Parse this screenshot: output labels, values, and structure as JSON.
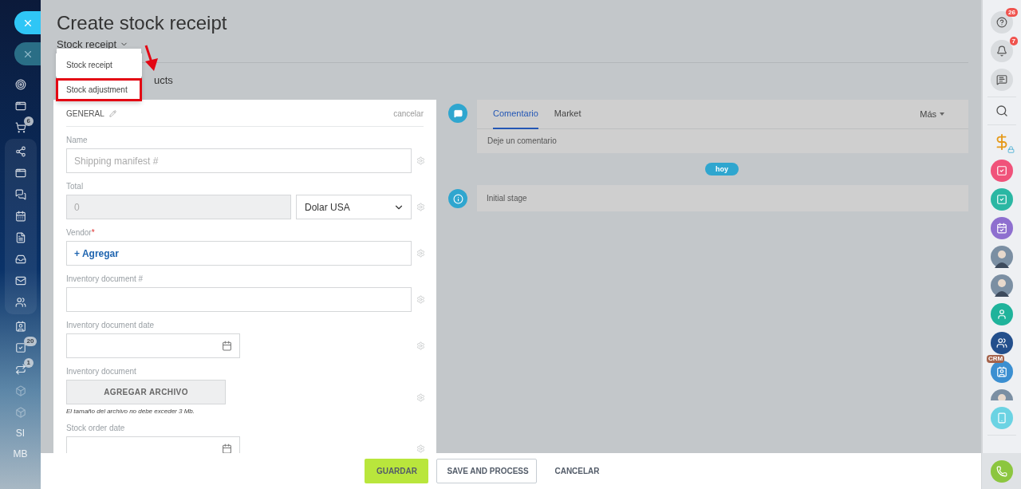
{
  "left_sidebar": {
    "sections": [
      {
        "grouped": false,
        "items": [
          {
            "kind": "close",
            "faded": false
          },
          {
            "kind": "close",
            "faded": true
          },
          {
            "kind": "icon"
          },
          {
            "kind": "icon"
          },
          {
            "kind": "icon",
            "badge": "6"
          }
        ]
      },
      {
        "grouped": true,
        "items": [
          {
            "kind": "icon"
          },
          {
            "kind": "icon"
          },
          {
            "kind": "icon"
          },
          {
            "kind": "icon"
          },
          {
            "kind": "icon"
          },
          {
            "kind": "icon"
          },
          {
            "kind": "icon"
          },
          {
            "kind": "icon"
          }
        ]
      },
      {
        "grouped": false,
        "items": [
          {
            "kind": "icon"
          },
          {
            "kind": "icon",
            "badge": "20"
          },
          {
            "kind": "icon",
            "badge": "1"
          },
          {
            "kind": "icon",
            "faded": true
          },
          {
            "kind": "icon",
            "faded": true
          },
          {
            "kind": "text",
            "label": "SI"
          },
          {
            "kind": "text",
            "label": "MB"
          }
        ]
      }
    ]
  },
  "page": {
    "title": "Create stock receipt",
    "type_selector": "Stock receipt",
    "tab_fragment": "ucts"
  },
  "type_menu": {
    "items": [
      {
        "label": "Stock receipt",
        "highlighted": false
      },
      {
        "label": "Stock adjustment",
        "highlighted": true
      }
    ]
  },
  "form": {
    "section": "GENERAL",
    "cancel": "cancelar",
    "fields": [
      {
        "kind": "text",
        "label": "Name",
        "placeholder": "Shipping manifest #"
      },
      {
        "kind": "money",
        "label": "Total",
        "value": "0",
        "currency": "Dolar USA"
      },
      {
        "kind": "entity",
        "label": "Vendor",
        "required": true,
        "required_mark": "*",
        "action": "+ Agregar"
      },
      {
        "kind": "text",
        "label": "Inventory document #"
      },
      {
        "kind": "date",
        "label": "Inventory document date"
      },
      {
        "kind": "file",
        "label": "Inventory document",
        "action": "AGREGAR ARCHIVO",
        "hint": "El tamaño del archivo no debe exceder 3 Mb."
      },
      {
        "kind": "date",
        "label": "Stock order date"
      }
    ]
  },
  "timeline": {
    "tabs": [
      {
        "label": "Comentario",
        "selected": true
      },
      {
        "label": "Market",
        "selected": false
      }
    ],
    "more": "Más",
    "comment_placeholder": "Deje un comentario",
    "divider": "hoy",
    "events": [
      {
        "text": "Initial stage"
      }
    ]
  },
  "right_sidebar": {
    "items": [
      {
        "kind": "help",
        "badge": "26"
      },
      {
        "kind": "bell",
        "badge": "7"
      },
      {
        "kind": "chat"
      },
      {
        "kind": "search"
      },
      {
        "kind": "dollar"
      },
      {
        "kind": "app",
        "color": "#f0527a"
      },
      {
        "kind": "app",
        "color": "#2bb7a3"
      },
      {
        "kind": "calendar",
        "color": "#8e6fcf"
      },
      {
        "kind": "avatar"
      },
      {
        "kind": "avatar"
      },
      {
        "kind": "user",
        "color": "#1fb39b"
      },
      {
        "kind": "group",
        "color": "#234f8c"
      },
      {
        "kind": "crm",
        "color": "#3b8fd1",
        "label": "CRM"
      },
      {
        "kind": "avatar_cut"
      },
      {
        "kind": "phone_cloud",
        "color": "#6bd3e3"
      },
      {
        "kind": "call",
        "color": "#8cc63f"
      }
    ]
  },
  "footer": {
    "buttons": [
      {
        "label": "GUARDAR",
        "kind": "primary"
      },
      {
        "label": "SAVE AND PROCESS",
        "kind": "secondary"
      },
      {
        "label": "CANCELAR",
        "kind": "link"
      }
    ]
  }
}
